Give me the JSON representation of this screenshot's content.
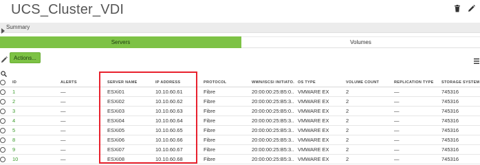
{
  "title": "UCS_Cluster_VDI",
  "icons": {
    "delete": "trash-icon",
    "edit": "pencil-icon",
    "summary_caret": "caret-right-icon",
    "toolbar_edit": "pencil-icon",
    "menu": "hamburger-menu-icon",
    "search": "search-icon"
  },
  "summary": {
    "label": "Summary"
  },
  "tabs": [
    {
      "label": "Servers",
      "active": true
    },
    {
      "label": "Volumes",
      "active": false
    }
  ],
  "toolbar": {
    "actions_label": "Actions..."
  },
  "colors": {
    "accent_green": "#7dc245",
    "highlight_red": "#e8202c",
    "id_link_green": "#3a9a2a"
  },
  "table": {
    "columns": [
      "ID",
      "ALERTS",
      "SERVER NAME",
      "IP ADDRESS",
      "PROTOCOL",
      "WWN/ISCSI INITIATO...",
      "OS TYPE",
      "VOLUME COUNT",
      "REPLICATION TYPE",
      "STORAGE SYSTEM ID"
    ],
    "rows": [
      [
        "1",
        "—",
        "ESXi01",
        "10.10.60.61",
        "Fibre",
        "20:00:00:25:B5:0...",
        "VMWARE EX",
        "2",
        "—",
        "745316"
      ],
      [
        "2",
        "—",
        "ESXi02",
        "10.10.60.62",
        "Fibre",
        "20:00:00:25:B5:3...",
        "VMWARE EX",
        "2",
        "—",
        "745316"
      ],
      [
        "3",
        "—",
        "ESXi03",
        "10.10.60.63",
        "Fibre",
        "20:00:00:25:B5:0...",
        "VMWARE EX",
        "2",
        "—",
        "745316"
      ],
      [
        "4",
        "—",
        "ESXi04",
        "10.10.60.64",
        "Fibre",
        "20:00:00:25:B5:3...",
        "VMWARE EX",
        "2",
        "—",
        "745316"
      ],
      [
        "5",
        "—",
        "ESXi05",
        "10.10.60.65",
        "Fibre",
        "20:00:00:25:B5:3...",
        "VMWARE EX",
        "2",
        "—",
        "745316"
      ],
      [
        "8",
        "—",
        "ESXi06",
        "10.10.60.66",
        "Fibre",
        "20:00:00:25:B5:3...",
        "VMWARE EX",
        "2",
        "—",
        "745316"
      ],
      [
        "9",
        "—",
        "ESXi07",
        "10.10.60.67",
        "Fibre",
        "20:00:00:25:B5:3...",
        "VMWARE EX",
        "2",
        "—",
        "745316"
      ],
      [
        "10",
        "—",
        "ESXi08",
        "10.10.60.68",
        "Fibre",
        "20:00:00:25:B5:3...",
        "VMWARE EX",
        "2",
        "—",
        "745316"
      ]
    ]
  }
}
